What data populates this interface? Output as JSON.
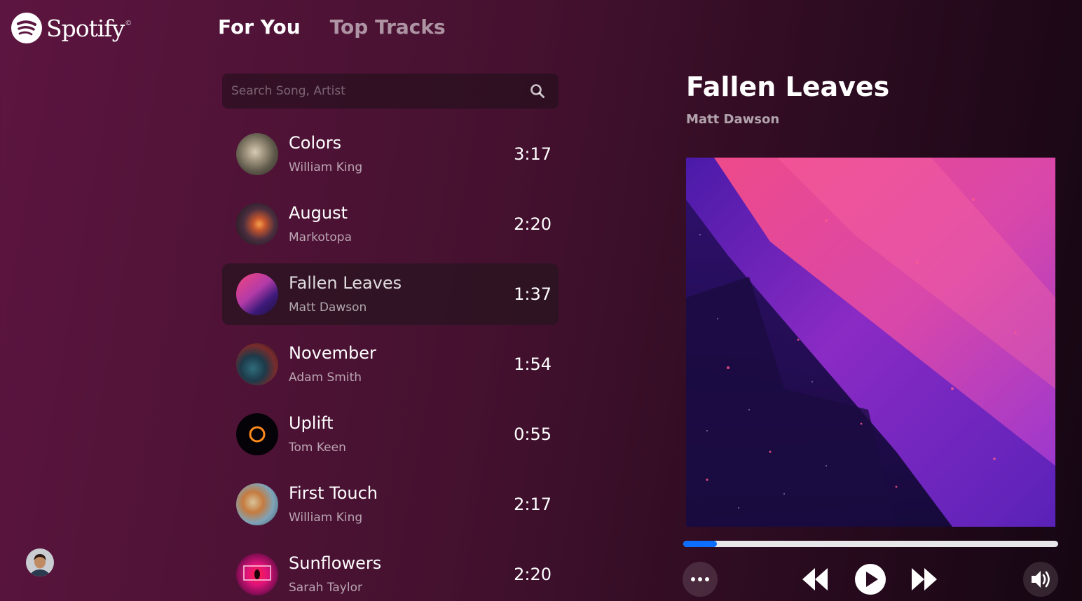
{
  "brand": {
    "name": "Spotify",
    "reg_mark": "©",
    "logo_icon": "spotify-logo-icon"
  },
  "nav": {
    "tabs": [
      {
        "label": "For You",
        "active": true
      },
      {
        "label": "Top Tracks",
        "active": false
      }
    ]
  },
  "search": {
    "placeholder": "Search Song, Artist",
    "value": "",
    "icon": "search-icon"
  },
  "tracks": [
    {
      "title": "Colors",
      "artist": "William King",
      "duration": "3:17",
      "active": false
    },
    {
      "title": "August",
      "artist": "Markotopa",
      "duration": "2:20",
      "active": false
    },
    {
      "title": "Fallen Leaves",
      "artist": "Matt Dawson",
      "duration": "1:37",
      "active": true
    },
    {
      "title": "November",
      "artist": "Adam Smith",
      "duration": "1:54",
      "active": false
    },
    {
      "title": "Uplift",
      "artist": "Tom Keen",
      "duration": "0:55",
      "active": false
    },
    {
      "title": "First Touch",
      "artist": "William King",
      "duration": "2:17",
      "active": false
    },
    {
      "title": "Sunflowers",
      "artist": "Sarah Taylor",
      "duration": "2:20",
      "active": false
    }
  ],
  "now_playing": {
    "title": "Fallen Leaves",
    "artist": "Matt Dawson",
    "progress": 0.09
  },
  "controls": {
    "menu_icon": "more-horizontal-icon",
    "prev_icon": "backward-icon",
    "play_icon": "play-icon",
    "next_icon": "forward-icon",
    "volume_icon": "volume-icon"
  },
  "colors": {
    "progress_fill": "#0d6efd",
    "progress_track": "#e7e7ea",
    "active_row": "#2a1420"
  }
}
